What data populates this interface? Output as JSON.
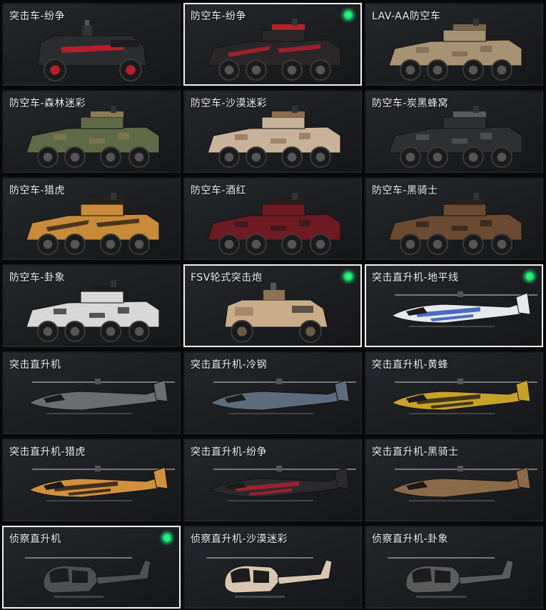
{
  "vehicles": [
    {
      "label": "突击车-纷争",
      "kind": "truck",
      "selected": false,
      "equipped": false,
      "skin": {
        "base": "#2a2c30",
        "accent": "#b4202a",
        "stripe": true
      }
    },
    {
      "label": "防空车-纷争",
      "kind": "aa",
      "selected": true,
      "equipped": true,
      "skin": {
        "base": "#2a2628",
        "accent": "#b8202c",
        "stripe": true
      }
    },
    {
      "label": "LAV-AA防空车",
      "kind": "aa",
      "selected": false,
      "equipped": false,
      "skin": {
        "base": "#a89274",
        "accent": "#7a6548",
        "stripe": false
      }
    },
    {
      "label": "防空车-森林迷彩",
      "kind": "aa",
      "selected": false,
      "equipped": false,
      "skin": {
        "base": "#5d6a45",
        "accent": "#8b7b52",
        "stripe": false
      }
    },
    {
      "label": "防空车-沙漠迷彩",
      "kind": "aa",
      "selected": false,
      "equipped": false,
      "skin": {
        "base": "#c8b39a",
        "accent": "#8f6d50",
        "stripe": false
      }
    },
    {
      "label": "防空车-炭黑蜂窝",
      "kind": "aa",
      "selected": false,
      "equipped": false,
      "skin": {
        "base": "#2e2f31",
        "accent": "#5a5b5d",
        "stripe": false
      }
    },
    {
      "label": "防空车-猎虎",
      "kind": "aa",
      "selected": false,
      "equipped": false,
      "skin": {
        "base": "#c98a3a",
        "accent": "#2b2018",
        "stripe": true
      }
    },
    {
      "label": "防空车-酒红",
      "kind": "aa",
      "selected": false,
      "equipped": false,
      "skin": {
        "base": "#6e1a22",
        "accent": "#2a1a1c",
        "stripe": false
      }
    },
    {
      "label": "防空车-黑骑士",
      "kind": "aa",
      "selected": false,
      "equipped": false,
      "skin": {
        "base": "#6a4a30",
        "accent": "#2a201a",
        "stripe": false
      }
    },
    {
      "label": "防空车-卦象",
      "kind": "aa",
      "selected": false,
      "equipped": false,
      "skin": {
        "base": "#d8d8d8",
        "accent": "#1c1c1c",
        "stripe": false
      }
    },
    {
      "label": "FSV轮式突击炮",
      "kind": "fsv",
      "selected": true,
      "equipped": true,
      "skin": {
        "base": "#c9ad8a",
        "accent": "#8c7255",
        "stripe": false
      }
    },
    {
      "label": "突击直升机-地平线",
      "kind": "heli",
      "selected": true,
      "equipped": true,
      "skin": {
        "base": "#e6e8ec",
        "accent": "#2f55b8",
        "stripe": true
      }
    },
    {
      "label": "突击直升机",
      "kind": "heli",
      "selected": false,
      "equipped": false,
      "skin": {
        "base": "#6b6d70",
        "accent": "#4a4c4f",
        "stripe": false
      }
    },
    {
      "label": "突击直升机-冷钢",
      "kind": "heli",
      "selected": false,
      "equipped": false,
      "skin": {
        "base": "#5d6c7c",
        "accent": "#3f4a56",
        "stripe": false
      }
    },
    {
      "label": "突击直升机-黄蜂",
      "kind": "heli",
      "selected": false,
      "equipped": false,
      "skin": {
        "base": "#c7a22a",
        "accent": "#2a2414",
        "stripe": true
      }
    },
    {
      "label": "突击直升机-猎虎",
      "kind": "heli",
      "selected": false,
      "equipped": false,
      "skin": {
        "base": "#d0903e",
        "accent": "#2a1e14",
        "stripe": true
      }
    },
    {
      "label": "突击直升机-纷争",
      "kind": "heli",
      "selected": false,
      "equipped": false,
      "skin": {
        "base": "#2a2a2e",
        "accent": "#b0202a",
        "stripe": true
      }
    },
    {
      "label": "突击直升机-黑骑士",
      "kind": "heli",
      "selected": false,
      "equipped": false,
      "skin": {
        "base": "#8a6a48",
        "accent": "#2c2218",
        "stripe": false
      }
    },
    {
      "label": "侦察直升机",
      "kind": "scout",
      "selected": true,
      "equipped": true,
      "skin": {
        "base": "#4d5052",
        "accent": "#36383a",
        "stripe": false
      }
    },
    {
      "label": "侦察直升机-沙漠迷彩",
      "kind": "scout",
      "selected": false,
      "equipped": false,
      "skin": {
        "base": "#d9c6b0",
        "accent": "#8a6a50",
        "stripe": false
      }
    },
    {
      "label": "侦察直升机-卦象",
      "kind": "scout",
      "selected": false,
      "equipped": false,
      "skin": {
        "base": "#5a5b5c",
        "accent": "#d0d0d0",
        "stripe": false
      }
    }
  ]
}
